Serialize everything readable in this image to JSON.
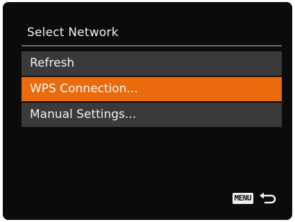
{
  "screen": {
    "title": "Select Network",
    "menu_items": [
      {
        "label": "Refresh",
        "selected": false
      },
      {
        "label": "WPS Connection...",
        "selected": true
      },
      {
        "label": "Manual Settings...",
        "selected": false
      }
    ],
    "footer": {
      "menu_key_label": "MENU",
      "back_icon": "back-arrow-icon"
    }
  },
  "colors": {
    "background": "#0b0b0b",
    "item_background": "#3a3a3a",
    "selected_background": "#ea6a0c",
    "text": "#f2f2f2"
  }
}
